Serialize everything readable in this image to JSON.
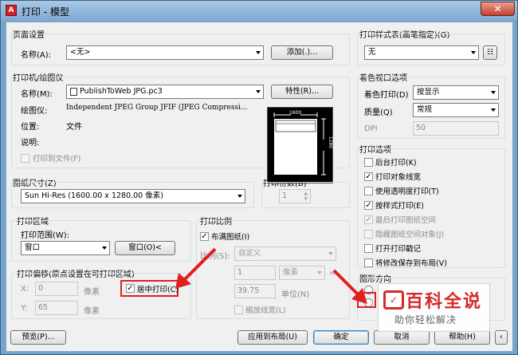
{
  "window": {
    "title": "打印 - 模型",
    "app_icon_text": "A",
    "close_label": "✕"
  },
  "page_setup": {
    "group_label": "页面设置",
    "name_label": "名称(A):",
    "name_value": "<无>",
    "add_button": "添加(.)..."
  },
  "printer": {
    "group_label": "打印机/绘图仪",
    "name_label": "名称(M):",
    "name_value": "PublishToWeb JPG.pc3",
    "properties_button": "特性(R)...",
    "plotter_label": "绘图仪:",
    "plotter_value": "Independent JPEG Group JFIF (JPEG Compressi...",
    "location_label": "位置:",
    "location_value": "文件",
    "description_label": "说明:",
    "print_to_file": "打印到文件(F)",
    "preview_top_dim": "1600",
    "preview_side_dim": "1280"
  },
  "paper_size": {
    "group_label": "图纸尺寸(Z)",
    "value": "Sun Hi-Res (1600.00 x 1280.00 像素)"
  },
  "copies": {
    "group_label": "打印份数(B)",
    "value": "1"
  },
  "plot_area": {
    "group_label": "打印区域",
    "range_label": "打印范围(W):",
    "range_value": "窗口",
    "window_button": "窗口(O)<"
  },
  "plot_offset": {
    "group_label": "打印偏移(原点设置在可打印区域)",
    "x_label": "X:",
    "x_value": "0",
    "x_unit": "像素",
    "y_label": "Y:",
    "y_value": "65",
    "y_unit": "像素",
    "center_label": "居中打印(C)"
  },
  "plot_scale": {
    "group_label": "打印比例",
    "fit_label": "布满图纸(I)",
    "scale_label": "比例(S):",
    "scale_value": "自定义",
    "value1": "1",
    "unit1": "像素",
    "value2": "39.75",
    "unit2": "单位(N)",
    "lineweights_label": "缩放线宽(L)"
  },
  "plot_style_table": {
    "group_label": "打印样式表(画笔指定)(G)",
    "value": "无"
  },
  "shaded_viewport": {
    "group_label": "着色视口选项",
    "shade_label": "着色打印(D)",
    "shade_value": "按显示",
    "quality_label": "质量(Q)",
    "quality_value": "常规",
    "dpi_label": "DPI",
    "dpi_value": "50"
  },
  "plot_options": {
    "group_label": "打印选项",
    "items": [
      {
        "label": "后台打印(K)",
        "checked": false,
        "enabled": true
      },
      {
        "label": "打印对象线宽",
        "checked": true,
        "enabled": true
      },
      {
        "label": "使用透明度打印(T)",
        "checked": false,
        "enabled": true
      },
      {
        "label": "按样式打印(E)",
        "checked": true,
        "enabled": true
      },
      {
        "label": "最后打印图纸空间",
        "checked": true,
        "enabled": false
      },
      {
        "label": "隐藏图纸空间对象(J)",
        "checked": false,
        "enabled": false
      },
      {
        "label": "打开打印戳记",
        "checked": false,
        "enabled": true
      },
      {
        "label": "将修改保存到布局(V)",
        "checked": false,
        "enabled": true
      }
    ]
  },
  "orientation": {
    "group_label": "图形方向"
  },
  "footer": {
    "preview_button": "预览(P)...",
    "apply_button": "应用到布局(U)",
    "ok_button": "确定",
    "cancel_button": "取消",
    "help_button": "帮助(H)"
  },
  "watermark": {
    "title": "百科全说",
    "subtitle": "助你轻松解决"
  },
  "colors": {
    "highlight_box": "#e02020",
    "title_bar": "#7fa9d1"
  }
}
